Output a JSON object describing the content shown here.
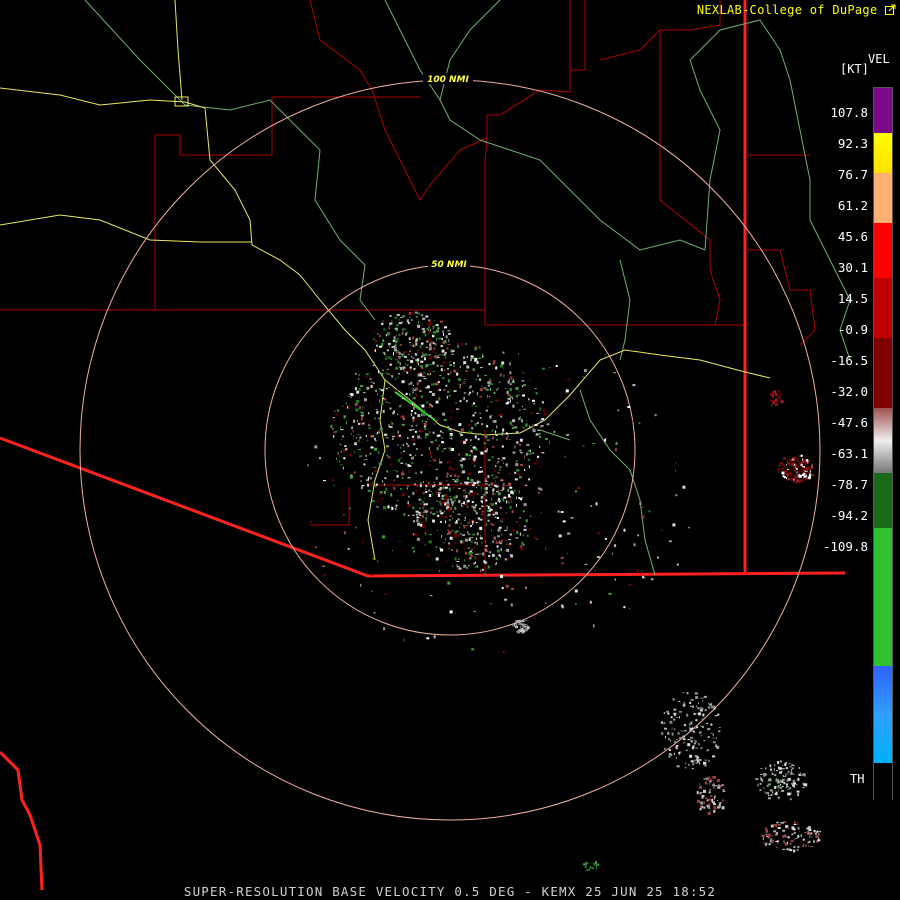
{
  "credit": "NEXLAB-College of DuPage",
  "credit_icon": "external-link-icon",
  "product_label": "VEL",
  "units_label": "[KT]",
  "range_rings": [
    {
      "label": "100 NMI"
    },
    {
      "label": "50 NMI"
    }
  ],
  "legend": {
    "ticks": [
      "107.8",
      "92.3",
      "76.7",
      "61.2",
      "45.6",
      "30.1",
      "14.5",
      "-0.9",
      "-16.5",
      "-32.0",
      "-47.6",
      "-63.1",
      "-78.7",
      "-94.2",
      "-109.8"
    ],
    "th_label": "TH"
  },
  "footer": "SUPER-RESOLUTION BASE VELOCITY 0.5 DEG - KEMX 25 JUN 25 18:52",
  "colors": {
    "border_red": "#ff2020",
    "county_red": "#b00000",
    "highway_yellow": "#e8e860",
    "river_green": "#70b070",
    "ring": "#f0b0a0"
  }
}
